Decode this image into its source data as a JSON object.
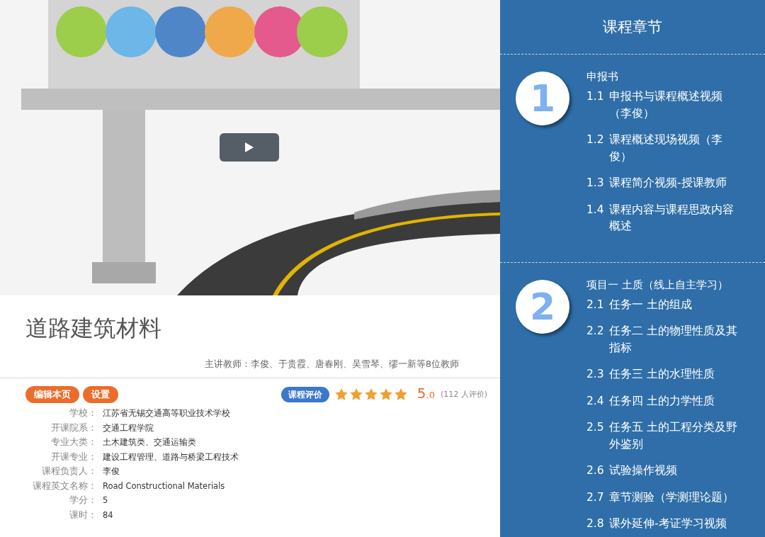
{
  "course": {
    "title": "道路建筑材料",
    "teachers": "主讲教师：李俊、于贵霞、唐春刚、吴雪琴、缪一新等8位教师"
  },
  "actions": [
    "编辑本页",
    "设置"
  ],
  "rating": {
    "label": "课程评价",
    "stars": 5,
    "score": "5$_{.0}$",
    "count": "(112 人评价)"
  },
  "info": [
    {
      "label": "学校：",
      "value": "江苏省无锡交通高等职业技术学校"
    },
    {
      "label": "开课院系：",
      "value": "交通工程学院"
    },
    {
      "label": "专业大类：",
      "value": "土木建筑类、交通运输类"
    },
    {
      "label": "开课专业：",
      "value": "建设工程管理、道路与桥梁工程技术"
    },
    {
      "label": "课程负责人：",
      "value": "李俊"
    },
    {
      "label": "课程英文名称：",
      "value": "Road Constructional Materials"
    },
    {
      "label": "学分：",
      "value": "5"
    },
    {
      "label": "课时：",
      "value": "84"
    }
  ],
  "chapters_panel": {
    "title": "课程章节",
    "chapters": [
      {
        "number": "1",
        "title": "申报书",
        "sections": [
          {
            "number": "1.1",
            "title": "申报书与课程概述视频（李俊）"
          },
          {
            "number": "1.2",
            "title": "课程概述现场视频（李俊）"
          },
          {
            "number": "1.3",
            "title": "课程简介视频-授课教师"
          },
          {
            "number": "1.4",
            "title": "课程内容与课程思政内容概述"
          }
        ]
      },
      {
        "number": "2",
        "title": "项目一 土质（线上自主学习）",
        "sections": [
          {
            "number": "2.1",
            "title": "任务一 土的组成"
          },
          {
            "number": "2.2",
            "title": "任务二 土的物理性质及其指标"
          },
          {
            "number": "2.3",
            "title": "任务三 土的水理性质"
          },
          {
            "number": "2.4",
            "title": "任务四 土的力学性质"
          },
          {
            "number": "2.5",
            "title": "任务五 土的工程分类及野外鉴别"
          },
          {
            "number": "2.6",
            "title": "试验操作视频"
          },
          {
            "number": "2.7",
            "title": "章节测验（学测理论题）"
          },
          {
            "number": "2.8",
            "title": "课外延伸-考证学习视频"
          }
        ]
      }
    ]
  }
}
